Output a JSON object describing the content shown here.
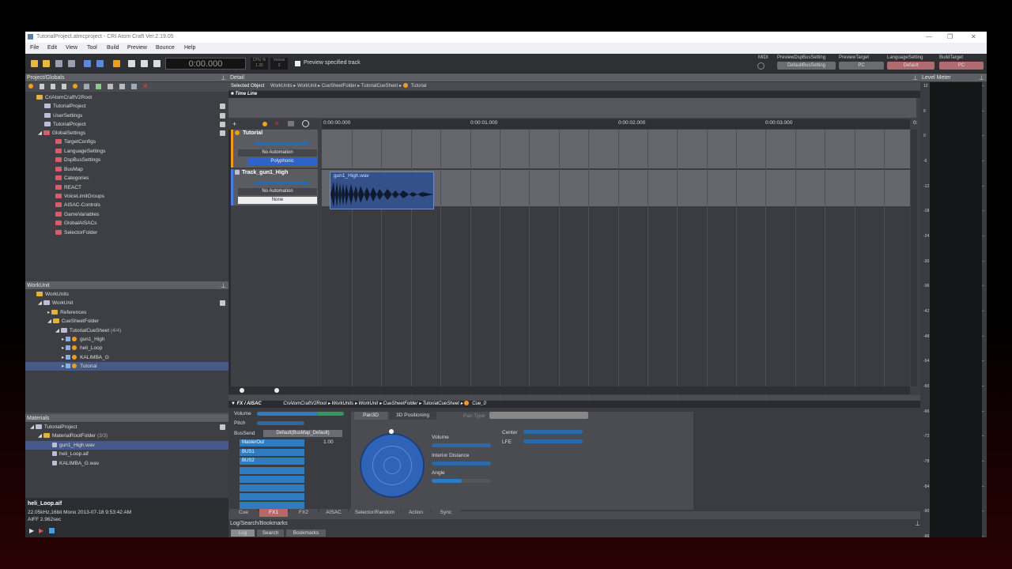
{
  "window": {
    "title": "TutorialProject.atmcproject - CRI Atom Craft Ver.2.19.05"
  },
  "menu": [
    "File",
    "Edit",
    "View",
    "Tool",
    "Build",
    "Preview",
    "Bounce",
    "Help"
  ],
  "toolbar": {
    "time": "0:00.000",
    "cpu_label": "CPU %",
    "cpu_value": "1.35",
    "voices_label": "Voices",
    "voices_value": "3",
    "preview_track": "Preview specified track",
    "midi": "MIDI",
    "dspbus_label": "PreviewDspBusSetting",
    "dspbus_value": "DefaultBusSetting",
    "target_label": "PreviewTarget",
    "target_value": "PC",
    "lang_label": "LanguageSetting",
    "lang_value": "Default",
    "build_label": "BuildTarget",
    "build_value": "PC"
  },
  "project": {
    "title": "Project/Globals",
    "items": [
      "CriAtomCraftV2Root",
      "TutorialProject",
      "UserSettings",
      "TutorialProject",
      "GlobalSettings",
      "TargetConfigs",
      "LanguageSettings",
      "DspBusSettings",
      "BusMap",
      "Categories",
      "REACT",
      "VoiceLimitGroups",
      "AISAC-Controls",
      "GameVariables",
      "GlobalAISACs",
      "SelectorFolder"
    ]
  },
  "workunit": {
    "title": "WorkUnit",
    "items": [
      "WorkUnits",
      "WorkUnit",
      "References",
      "CueSheetFolder",
      "TutorialCueSheet",
      "(4/4)",
      "gun1_High",
      "heli_Loop",
      "KALIMBA_G",
      "Tutorial"
    ]
  },
  "materials": {
    "title": "Materials",
    "items": [
      "TutorialProject",
      "MaterialRootFolder",
      "(3/3)",
      "gun1_High.wav",
      "heli_Loop.aif",
      "KALIMBA_G.wav"
    ],
    "info_name": "heli_Loop.aif",
    "info_line1": "22.05kHz,16bit Mono   2013-07-18 9:53:42 AM",
    "info_line2": "AIFF 2.962sec"
  },
  "detail": {
    "title": "Detail",
    "selected_object": "Selected Object",
    "breadcrumb": [
      "WorkUnits",
      "WorkUnit",
      "CueSheetFolder",
      "TutorialCueSheet",
      "Tutorial"
    ],
    "timeline": "Time Line",
    "ruler": [
      "0:00:00.000",
      "0:00:01.000",
      "0:00:02.000",
      "0:00:03.000",
      "0:"
    ],
    "track1": {
      "name": "Tutorial",
      "automation": "No Automation",
      "mode": "Polyphonic"
    },
    "track2": {
      "name": "Track_gun1_High",
      "automation": "No Automation",
      "mode": "None"
    },
    "waveform_label": "gun1_High.wav"
  },
  "fx": {
    "title": "FX / AISAC",
    "breadcrumb": [
      "CriAtomCraftV2Root",
      "WorkUnits",
      "WorkUnit",
      "CueSheetFolder",
      "TutorialCueSheet",
      "Cue_0"
    ],
    "volume": "Volume",
    "pitch": "Pitch",
    "bussend": "BusSend",
    "bussend_value": "Default(BusMap_Default)",
    "buses": [
      "MasterOut",
      "BUS1",
      "BUS2"
    ],
    "bus_value": "1.00",
    "tabs_top": [
      "Pan3D",
      "3D Positioning"
    ],
    "pan_type": "Pan Type",
    "knobs": [
      "Volume",
      "Interior Distance",
      "Angle"
    ],
    "center": "Center",
    "lfe": "LFE",
    "tabs_bottom": [
      "Cue",
      "FX1",
      "FX2",
      "AISAC",
      "Selector/Random",
      "Action",
      "Sync"
    ]
  },
  "meter": {
    "title": "Level Meter",
    "marks": [
      "12",
      "6",
      "0",
      "-6",
      "-12",
      "-18",
      "-24",
      "-30",
      "-36",
      "-42",
      "-48",
      "-54",
      "-60",
      "-66",
      "-72",
      "-78",
      "-84",
      "-90",
      "-96"
    ]
  },
  "log": {
    "title": "Log/Search/Bookmarks",
    "tabs": [
      "Log",
      "Search",
      "Bookmarks"
    ]
  }
}
